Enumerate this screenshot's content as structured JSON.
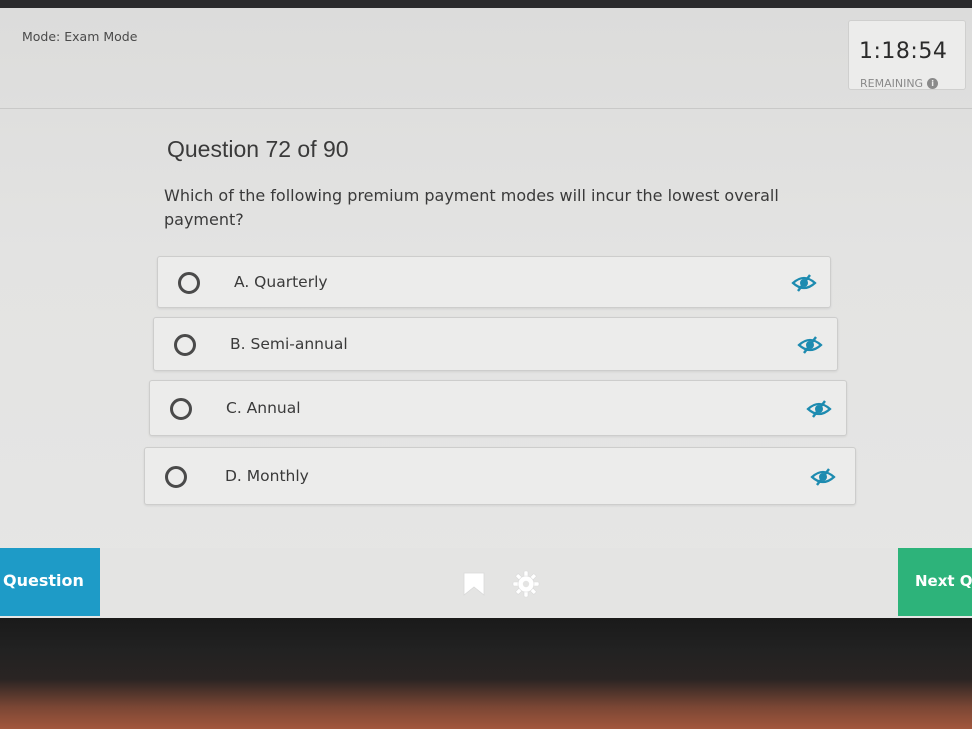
{
  "header": {
    "mode_text": "Mode: Exam Mode",
    "timer": {
      "time": "1:18:54",
      "label": "REMAINING",
      "info_glyph": "i"
    }
  },
  "question": {
    "counter": "Question 72 of 90",
    "text": "Which of the following premium payment modes will incur the lowest overall payment?"
  },
  "options": [
    {
      "label": "A. Quarterly",
      "selected": false,
      "eye_icon": "eye-slash-icon"
    },
    {
      "label": "B. Semi-annual",
      "selected": false,
      "eye_icon": "eye-slash-icon"
    },
    {
      "label": "C. Annual",
      "selected": false,
      "eye_icon": "eye-slash-icon"
    },
    {
      "label": "D. Monthly",
      "selected": false,
      "eye_icon": "eye-slash-icon"
    }
  ],
  "footer": {
    "question_tab_label": "Question",
    "next_label": "Next Q",
    "tools": [
      "bookmark-icon",
      "gear-icon"
    ]
  },
  "colors": {
    "accent_blue": "#1e9bc7",
    "accent_green": "#2db37a",
    "eye_icon": "#1d8bb0"
  }
}
